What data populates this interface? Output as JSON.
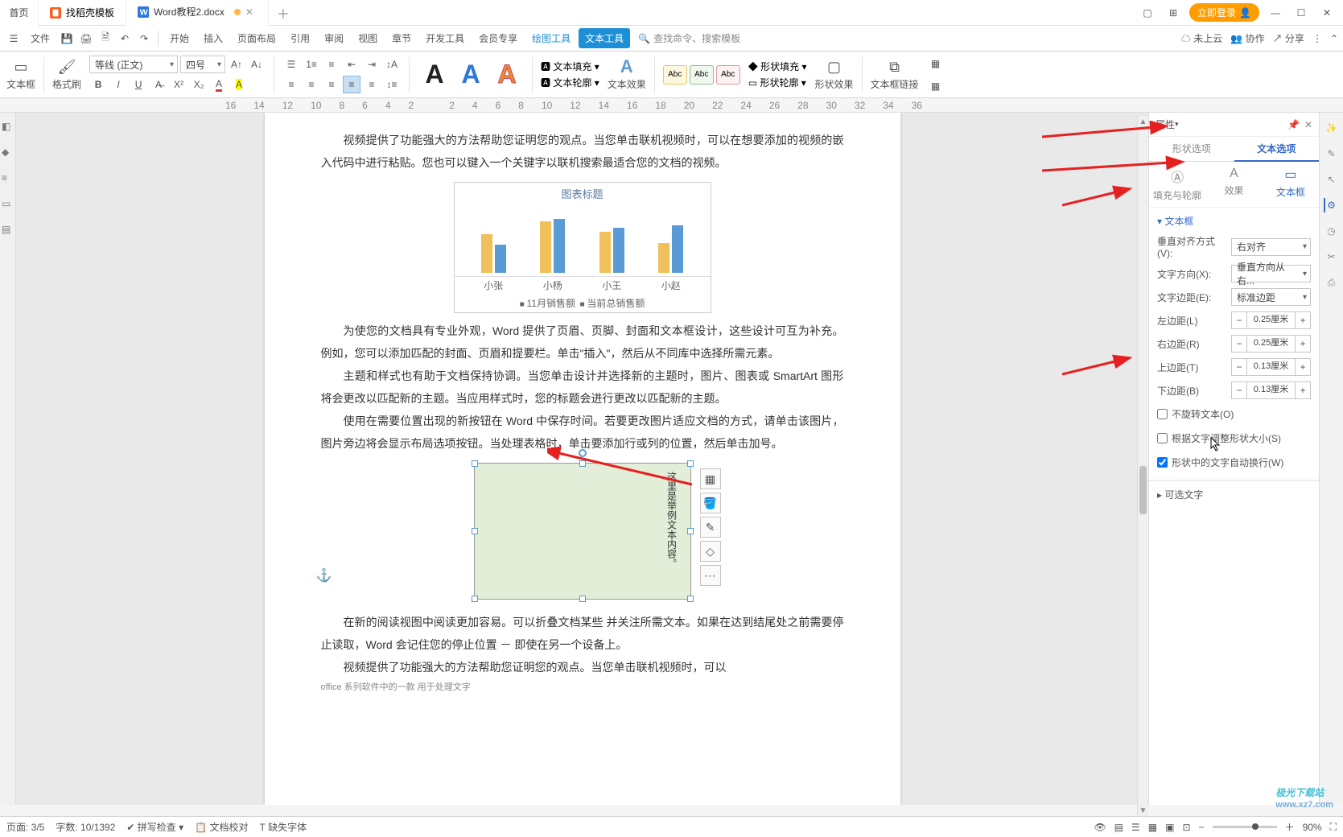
{
  "titlebar": {
    "home": "首页",
    "tabs": [
      {
        "label": "找稻壳模板",
        "color": "#ff5a1f"
      },
      {
        "label": "Word教程2.docx",
        "color": "#2b78d9",
        "active": true
      }
    ],
    "login": "立即登录"
  },
  "menubar": {
    "file": "文件",
    "items": [
      "开始",
      "插入",
      "页面布局",
      "引用",
      "审阅",
      "视图",
      "章节",
      "开发工具",
      "会员专享"
    ],
    "context": [
      "绘图工具",
      "文本工具"
    ],
    "search_placeholder": "查找命令、搜索模板",
    "right": [
      "未上云",
      "协作",
      "分享"
    ]
  },
  "ribbon": {
    "textbox": "文本框",
    "brush": "格式刷",
    "font_family": "等线 (正文)",
    "font_size": "四号",
    "text_fill": "文本填充",
    "text_outline": "文本轮廓",
    "text_effect": "文本效果",
    "shape_fill": "形状填充",
    "shape_outline": "形状轮廓",
    "shape_effect": "形状效果",
    "textbox_link": "文本框链接"
  },
  "ruler": [
    "16",
    "14",
    "12",
    "10",
    "8",
    "6",
    "4",
    "2",
    "",
    "2",
    "4",
    "6",
    "8",
    "10",
    "12",
    "14",
    "16",
    "18",
    "20",
    "22",
    "24",
    "26",
    "28",
    "30",
    "32",
    "34",
    "36"
  ],
  "document": {
    "p1": "视频提供了功能强大的方法帮助您证明您的观点。当您单击联机视频时，可以在想要添加的视频的嵌入代码中进行粘贴。您也可以键入一个关键字以联机搜索最适合您的文档的视频。",
    "p2": "为使您的文档具有专业外观，Word 提供了页眉、页脚、封面和文本框设计，这些设计可互为补充。例如，您可以添加匹配的封面、页眉和提要栏。单击\"插入\"，然后从不同库中选择所需元素。",
    "p3": "主题和样式也有助于文档保持协调。当您单击设计并选择新的主题时，图片、图表或 SmartArt 图形将会更改以匹配新的主题。当应用样式时，您的标题会进行更改以匹配新的主题。",
    "p4": "使用在需要位置出现的新按钮在 Word 中保存时间。若要更改图片适应文档的方式，请单击该图片，图片旁边将会显示布局选项按钮。当处理表格时，单击要添加行或列的位置，然后单击加号。",
    "p5": "在新的阅读视图中阅读更加容易。可以折叠文档某些       并关注所需文本。如果在达到结尾处之前需要停止读取，Word 会记住您的停止位置 － 即使在另一个设备上。",
    "p6": "视频提供了功能强大的方法帮助您证明您的观点。当您单击联机视频时，可以",
    "p7": "office 系列软件中的一款   用于处理文字",
    "textbox_lines": [
      "这里是举例文本",
      "内容。"
    ]
  },
  "chart_data": {
    "type": "bar",
    "title": "图表标题",
    "categories": [
      "小张",
      "小杨",
      "小王",
      "小赵"
    ],
    "series": [
      {
        "name": "11月销售额",
        "values": [
          1800,
          2400,
          1900,
          1400
        ]
      },
      {
        "name": "当前总销售额",
        "values": [
          1300,
          2500,
          2100,
          2200
        ]
      }
    ],
    "ylim": [
      0,
      3000
    ],
    "yticks": [
      1000,
      2000
    ],
    "legend": [
      "11月销售额",
      "当前总销售额"
    ]
  },
  "panel": {
    "header": "属性",
    "tabs1": [
      "形状选项",
      "文本选项"
    ],
    "tabs2": [
      "填充与轮廓",
      "效果",
      "文本框"
    ],
    "section": "文本框",
    "valign_label": "垂直对齐方式(V):",
    "valign_value": "右对齐",
    "dir_label": "文字方向(X):",
    "dir_value": "垂直方向从右...",
    "margin_label": "文字边距(E):",
    "margin_value": "标准边距",
    "left_label": "左边距(L)",
    "right_label": "右边距(R)",
    "top_label": "上边距(T)",
    "bottom_label": "下边距(B)",
    "left_val": "0.25厘米",
    "right_val": "0.25厘米",
    "top_val": "0.13厘米",
    "bottom_val": "0.13厘米",
    "chk1": "不旋转文本(O)",
    "chk2": "根据文字调整形状大小(S)",
    "chk3": "形状中的文字自动换行(W)",
    "optional": "可选文字"
  },
  "status": {
    "page": "页面: 3/5",
    "words": "字数: 10/1392",
    "spell": "拼写检查",
    "proof": "文档校对",
    "missing_font": "缺失字体",
    "zoom": "90%"
  },
  "watermark": {
    "name": "极光下载站",
    "url": "www.xz7.com"
  }
}
